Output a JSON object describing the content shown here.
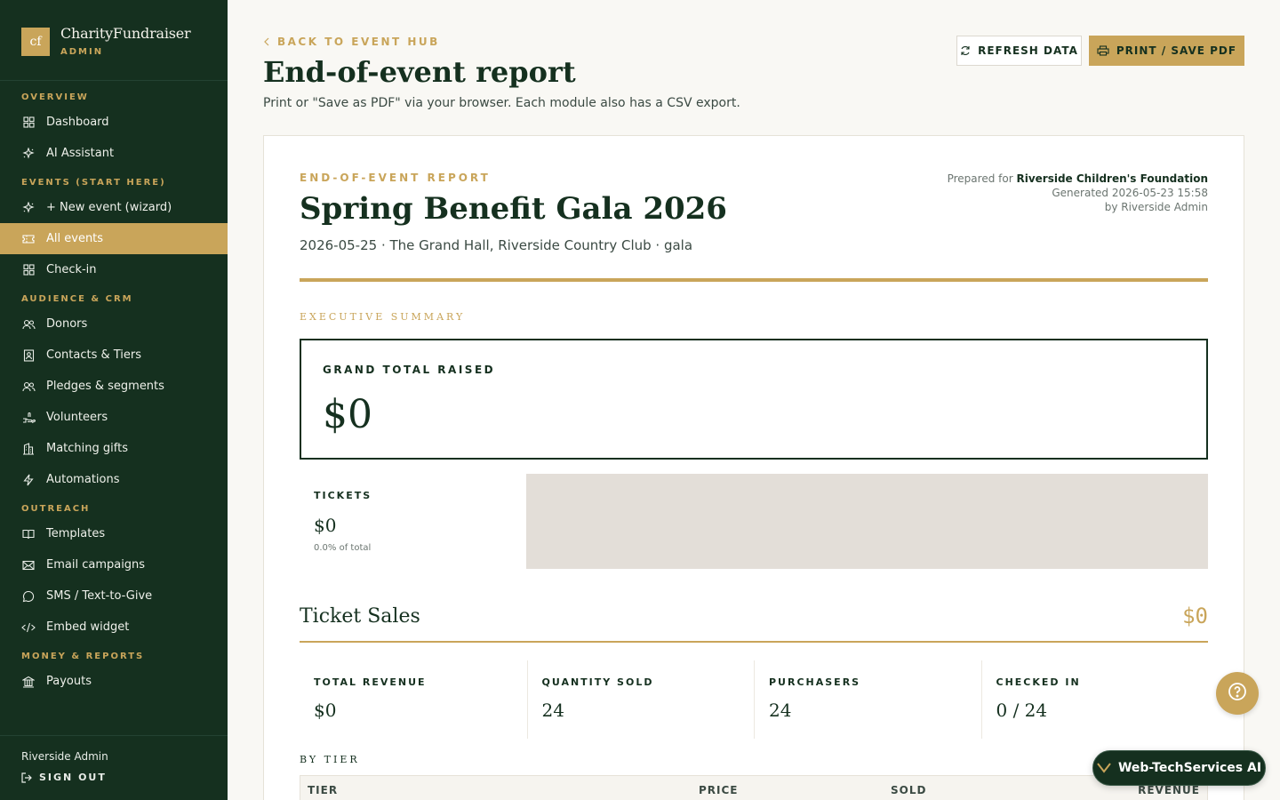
{
  "brand": {
    "logo_text": "cf",
    "name": "CharityFundraiser",
    "role": "ADMIN"
  },
  "sidebar": {
    "sections": [
      {
        "label": "OVERVIEW",
        "items": [
          {
            "label": "Dashboard",
            "icon": "grid-icon"
          },
          {
            "label": "AI Assistant",
            "icon": "sparkle-icon"
          }
        ]
      },
      {
        "label": "EVENTS (START HERE)",
        "items": [
          {
            "label": "+ New event (wizard)",
            "icon": "sparkle-icon"
          },
          {
            "label": "All events",
            "icon": "ticket-icon",
            "active": true
          },
          {
            "label": "Check-in",
            "icon": "grid-icon"
          }
        ]
      },
      {
        "label": "AUDIENCE & CRM",
        "items": [
          {
            "label": "Donors",
            "icon": "users-icon"
          },
          {
            "label": "Contacts & Tiers",
            "icon": "contact-icon"
          },
          {
            "label": "Pledges & segments",
            "icon": "users-icon"
          },
          {
            "label": "Volunteers",
            "icon": "hand-icon"
          },
          {
            "label": "Matching gifts",
            "icon": "building-icon"
          },
          {
            "label": "Automations",
            "icon": "bolt-icon"
          }
        ]
      },
      {
        "label": "OUTREACH",
        "items": [
          {
            "label": "Templates",
            "icon": "book-icon"
          },
          {
            "label": "Email campaigns",
            "icon": "mail-icon"
          },
          {
            "label": "SMS / Text-to-Give",
            "icon": "chat-icon"
          },
          {
            "label": "Embed widget",
            "icon": "code-icon"
          }
        ]
      },
      {
        "label": "MONEY & REPORTS",
        "items": [
          {
            "label": "Payouts",
            "icon": "bank-icon"
          }
        ]
      }
    ],
    "footer": {
      "user": "Riverside Admin",
      "signout": "SIGN OUT"
    }
  },
  "header": {
    "back": "BACK TO EVENT HUB",
    "title": "End-of-event report",
    "subtitle": "Print or \"Save as PDF\" via your browser. Each module also has a CSV export.",
    "refresh": "REFRESH DATA",
    "print": "PRINT / SAVE PDF"
  },
  "report": {
    "kicker": "END-OF-EVENT REPORT",
    "event_name": "Spring Benefit Gala 2026",
    "meta": "2026-05-25 · The Grand Hall, Riverside Country Club · gala",
    "prepared_for_label": "Prepared for",
    "organization": "Riverside Children's Foundation",
    "generated": "Generated 2026-05-23 15:58",
    "by": "by Riverside Admin",
    "exec_label": "EXECUTIVE SUMMARY",
    "grand_total_label": "GRAND TOTAL RAISED",
    "grand_total": "$0",
    "tickets_label": "TICKETS",
    "tickets_value": "$0",
    "tickets_pct": "0.0% of total",
    "tickets_share": 0.0,
    "ticket_sales": {
      "title": "Ticket Sales",
      "amount": "$0",
      "stats": [
        {
          "label": "TOTAL REVENUE",
          "value": "$0"
        },
        {
          "label": "QUANTITY SOLD",
          "value": "24"
        },
        {
          "label": "PURCHASERS",
          "value": "24"
        },
        {
          "label": "CHECKED IN",
          "value": "0 / 24"
        }
      ],
      "by_tier_label": "BY TIER",
      "columns": [
        "TIER",
        "PRICE",
        "SOLD",
        "REVENUE"
      ]
    }
  },
  "floating": {
    "ai_label": "Web-TechServices AI"
  },
  "colors": {
    "sidebar": "#15301f",
    "accent": "#c9a55a",
    "background": "#f9f8f4"
  }
}
